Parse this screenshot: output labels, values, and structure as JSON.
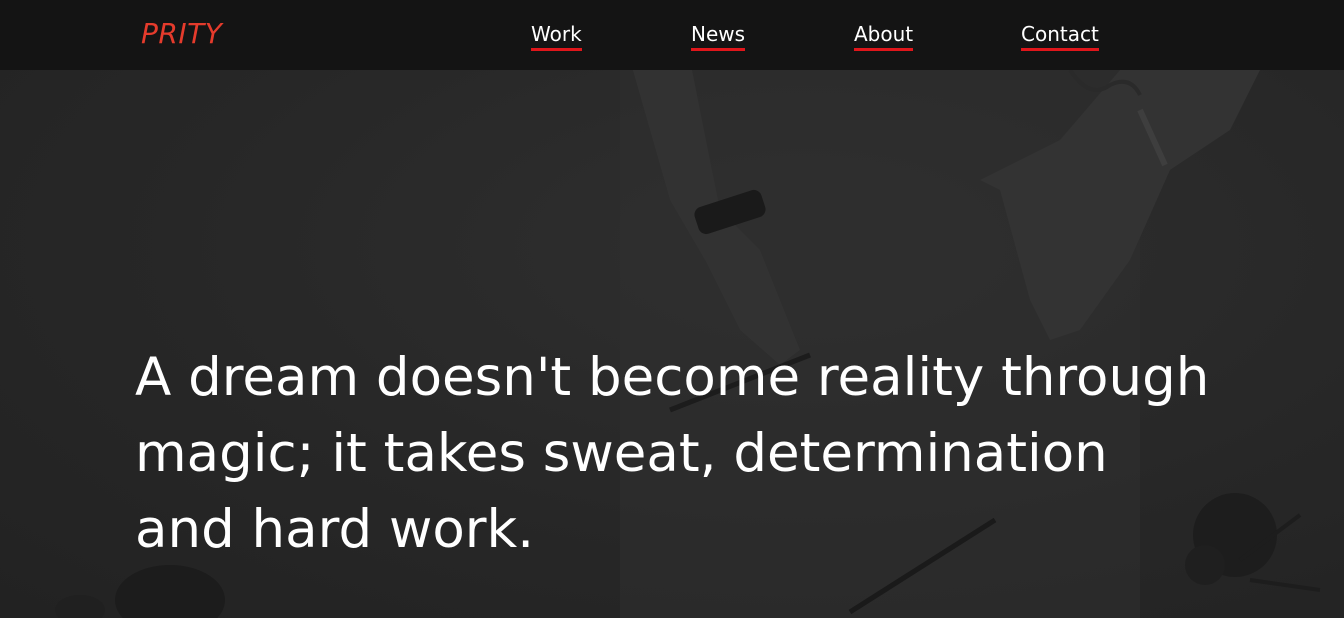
{
  "brand": {
    "logo_text": "PRITY",
    "accent_color": "#e53b2c",
    "underline_color": "#e0161b"
  },
  "nav": {
    "items": [
      {
        "label": "Work"
      },
      {
        "label": "News"
      },
      {
        "label": "About"
      },
      {
        "label": "Contact"
      }
    ]
  },
  "hero": {
    "quote": "A dream doesn't become reality through magic; it takes sweat, determination and hard work.",
    "background_image": "desk-scene-with-hands-and-plant"
  }
}
